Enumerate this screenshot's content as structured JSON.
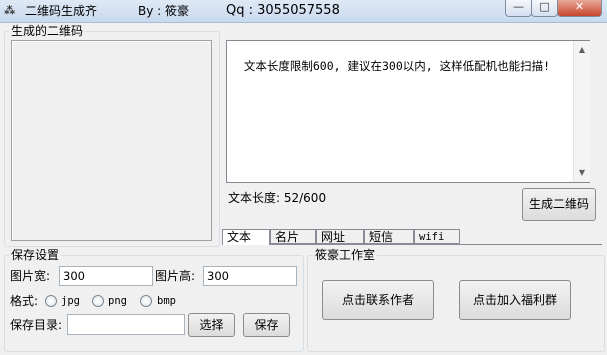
{
  "window": {
    "title": "二维码生成齐",
    "author": "By : 筱豪",
    "qq": "Qq : 3055057558",
    "icon_glyph": "⁂",
    "minimize": "—",
    "maximize": "□",
    "close": "✕"
  },
  "qr_group": {
    "label": "生成的二维码"
  },
  "text_panel": {
    "content": "文本长度限制600, 建议在300以内, 这样低配机也能扫描!",
    "length_label": "文本长度: 52/600",
    "generate_button": "生成二维码"
  },
  "tabs": [
    {
      "label": "文本"
    },
    {
      "label": "名片"
    },
    {
      "label": "网址"
    },
    {
      "label": "短信"
    },
    {
      "label": "wifi"
    }
  ],
  "save": {
    "label": "保存设置",
    "width_label": "图片宽:",
    "width_value": "300",
    "height_label": "图片高:",
    "height_value": "300",
    "format_label": "格式:",
    "formats": [
      "jpg",
      "png",
      "bmp"
    ],
    "dir_label": "保存目录:",
    "dir_value": "",
    "choose_button": "选择",
    "save_button": "保存"
  },
  "studio": {
    "label": "筱豪工作室",
    "contact_button": "点击联系作者",
    "join_button": "点击加入福利群"
  }
}
